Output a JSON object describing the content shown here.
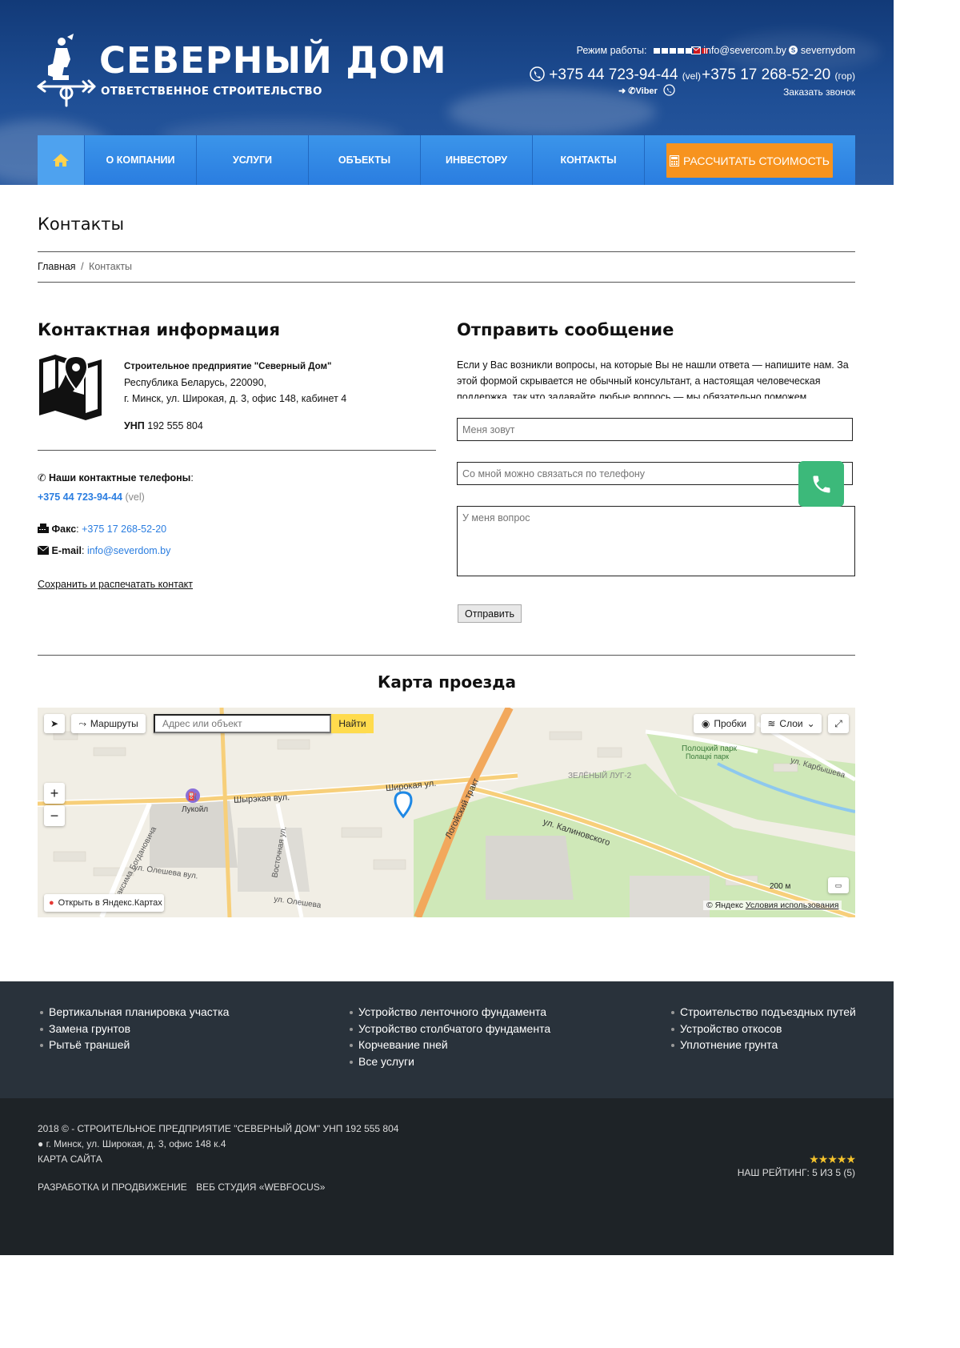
{
  "header": {
    "brand": "СЕВЕРНЫЙ ДОМ",
    "slogan": "ОТВЕТСТВЕННОЕ СТРОИТЕЛЬСТВО",
    "work_label": "Режим работы:",
    "email": "info@severcom.by",
    "skype": "severnydom",
    "phone_mobile": "+375 44 723-94-44",
    "phone_mobile_op": "(vel)",
    "viber": "Viber",
    "phone_city": "+375 17 268-52-20",
    "phone_city_op": "(гор)",
    "callback": "Заказать звонок"
  },
  "nav": {
    "items": [
      "О КОМПАНИИ",
      "УСЛУГИ",
      "ОБЪЕКТЫ",
      "ИНВЕСТОРУ",
      "КОНТАКТЫ"
    ],
    "calc_label": "РАССЧИТАТЬ СТОИМОСТЬ"
  },
  "page": {
    "title": "Контакты",
    "breadcrumb_home": "Главная",
    "breadcrumb_sep": "/",
    "breadcrumb_current": "Контакты"
  },
  "contacts": {
    "heading": "Контактная информация",
    "company": "Строительное предприятие \"Северный Дом\"",
    "address1": "Республика Беларусь, 220090,",
    "address2": "г. Минск, ул. Широкая, д. 3, офис 148, кабинет 4",
    "unp_label": "УНП",
    "unp": "192 555 804",
    "phones_label": "Наши контактные телефоны",
    "phone": "+375 44 723-94-44",
    "phone_op": "(vel)",
    "fax_label": "Факс",
    "fax": "+375 17 268-52-20",
    "email_label": "E-mail",
    "email": "info@severdom.by",
    "save_link": "Сохранить и распечатать контакт"
  },
  "form": {
    "heading": "Отправить сообщение",
    "intro": "Если у Вас возникли вопросы, на которые Вы не нашли ответа — напишите нам. За этой формой скрывается не обычный консультант, а настоящая человеческая поддержка, так что задавайте любые вопрось — мы обязательно поможем",
    "name_placeholder": "Меня зовут",
    "phone_placeholder": "Со мной можно связаться по телефону",
    "question_placeholder": "У меня вопрос",
    "submit": "Отправить"
  },
  "map": {
    "title": "Карта проезда",
    "routes": "Маршруты",
    "address_placeholder": "Адрес или объект",
    "find": "Найти",
    "traffic": "Пробки",
    "layers": "Слои",
    "open_in": "Открыть в Яндекс.Картах",
    "copyright": "© Яндекс",
    "terms": "Условия использования",
    "scale": "200 м",
    "labels": {
      "shirokaya": "Широкая ул.",
      "shyrskaya": "Шырэкая вул.",
      "logoisky": "Логойский тракт",
      "kalinovskogo": "ул. Калиновского",
      "zeleny": "ЗЕЛЁНЫЙ ЛУГ-2",
      "park": "Полоцкий парк",
      "park_by": "Полацкі парк",
      "karbysheva": "ул. Карбышева",
      "lukoil": "Лукойл",
      "olesheva": "ул. Олешева",
      "olesheva_by": "ул. Олешева вул.",
      "bogdanovicha": "Максима Богдановича",
      "vostochnaya": "Восточная ул."
    }
  },
  "footer": {
    "col1": [
      "Вертикальная планировка участка",
      "Замена грунтов",
      "Рытьё траншей"
    ],
    "col2": [
      "Устройство ленточного фундамента",
      "Устройство столбчатого фундамента",
      "Корчевание пней",
      "Все услуги"
    ],
    "col3": [
      "Строительство подъездных путей",
      "Устройство откосов",
      "Уплотнение грунта"
    ],
    "copyright": "2018 © - СТРОИТЕЛЬНОЕ ПРЕДПРИЯТИЕ \"СЕВЕРНЫЙ ДОМ\" УНП 192 555 804",
    "address": "г. Минск, ул. Широкая, д. 3, офис 148 к.4",
    "sitemap": "КАРТА САЙТА",
    "dev": "РАЗРАБОТКА И ПРОДВИЖЕНИЕ",
    "studio": "ВЕБ СТУДИЯ «WEBFOCUS»",
    "rating": "НАШ РЕЙТИНГ: 5 ИЗ 5 (5)",
    "stars": "★★★★★"
  },
  "colors": {
    "nav": "#2a7de0",
    "accent": "#f7931e",
    "call": "#3cb97a",
    "link": "#2a7de0"
  },
  "icons": [
    "weathervane-logo",
    "phone-icon",
    "viber-icon",
    "whatsapp-icon",
    "mail-icon",
    "skype-icon",
    "home-icon",
    "calculator-icon",
    "map-pin-icon",
    "fax-icon",
    "envelope-icon"
  ]
}
